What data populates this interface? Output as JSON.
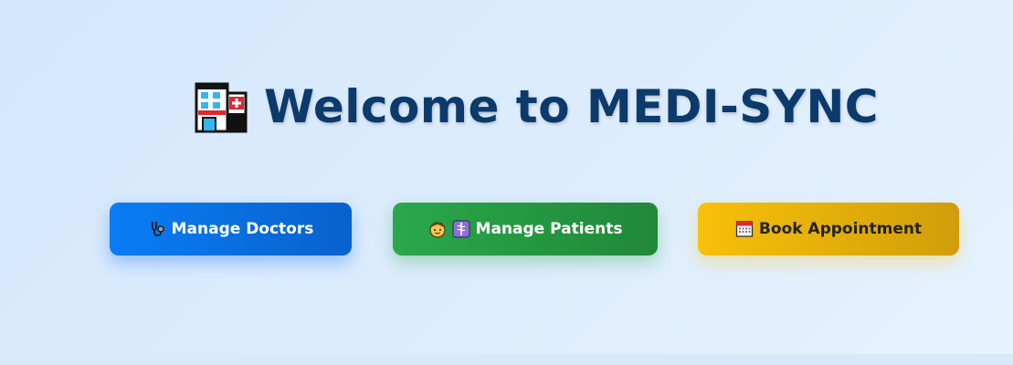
{
  "header": {
    "title": "Welcome to MEDI-SYNC",
    "icon": "hospital-icon"
  },
  "actions": [
    {
      "label": "Manage Doctors",
      "icons": [
        "stethoscope-icon"
      ],
      "color": "#0a7cf4"
    },
    {
      "label": "Manage Patients",
      "icons": [
        "boy-face-icon",
        "medical-symbol-icon"
      ],
      "color": "#28a745"
    },
    {
      "label": "Book Appointment",
      "icons": [
        "calendar-icon"
      ],
      "color": "#f8c009"
    }
  ],
  "colors": {
    "title": "#0b3a6b",
    "background": "#dcecfd"
  }
}
